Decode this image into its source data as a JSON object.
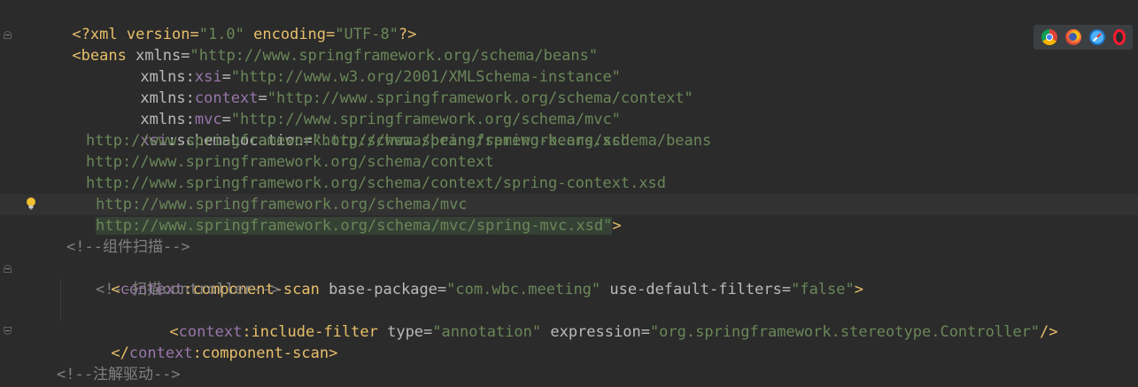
{
  "editor": {
    "lines": [
      {
        "kind": "decl",
        "text_a": "<?xml version=",
        "text_b": "\"1.0\"",
        "text_c": " encoding=",
        "text_d": "\"UTF-8\"",
        "text_e": "?>"
      },
      {
        "open": "<beans",
        "attr": " xmlns=",
        "value": "\"http://www.springframework.org/schema/beans\""
      },
      {
        "attr_a": "xmlns:",
        "ns": "xsi",
        "attr_b": "=",
        "value": "\"http://www.w3.org/2001/XMLSchema-instance\""
      },
      {
        "attr_a": "xmlns:",
        "ns": "context",
        "attr_b": "=",
        "value": "\"http://www.springframework.org/schema/context\""
      },
      {
        "attr_a": "xmlns:",
        "ns": "mvc",
        "attr_b": "=",
        "value": "\"http://www.springframework.org/schema/mvc\""
      },
      {
        "ns": "xsi",
        "attr_b": ":schemaLocation=",
        "value": "\"http://www.springframework.org/schema/beans"
      },
      {
        "value": "http://www.springframework.org/schema/beans/spring-beans.xsd"
      },
      {
        "value": "http://www.springframework.org/schema/context"
      },
      {
        "value": "http://www.springframework.org/schema/context/spring-context.xsd"
      },
      {
        "value": "http://www.springframework.org/schema/mvc"
      },
      {
        "value": "http://www.springframework.org/schema/mvc/spring-mvc.xsd\"",
        "close": ">"
      },
      {
        "comment": "<!--组件扫描-->"
      },
      {
        "open": "<",
        "ns": "context",
        "tag": ":component-scan",
        "attr_a": " base-package=",
        "value_a": "\"com.wbc.meeting\"",
        "attr_b": " use-default-filters=",
        "value_b": "\"false\"",
        "close": ">"
      },
      {
        "comment": "<!--扫描controller-->"
      },
      {
        "open": "<",
        "ns": "context",
        "tag": ":include-filter",
        "attr_a": " type=",
        "value_a": "\"annotation\"",
        "attr_b": " expression=",
        "value_b": "\"org.springframework.stereotype.Controller\"",
        "close": "/>"
      },
      {
        "open": "</",
        "ns": "context",
        "tag": ":component-scan",
        "close": ">"
      },
      {},
      {
        "comment": "<!--注解驱动-->"
      }
    ]
  },
  "browser_bar": {
    "icons": [
      "chrome-icon",
      "firefox-icon",
      "safari-icon",
      "opera-icon"
    ]
  },
  "colors": {
    "background": "#2b2b2b",
    "tag": "#e8bf6a",
    "namespace": "#9876aa",
    "value": "#6a8759",
    "comment": "#808080"
  }
}
